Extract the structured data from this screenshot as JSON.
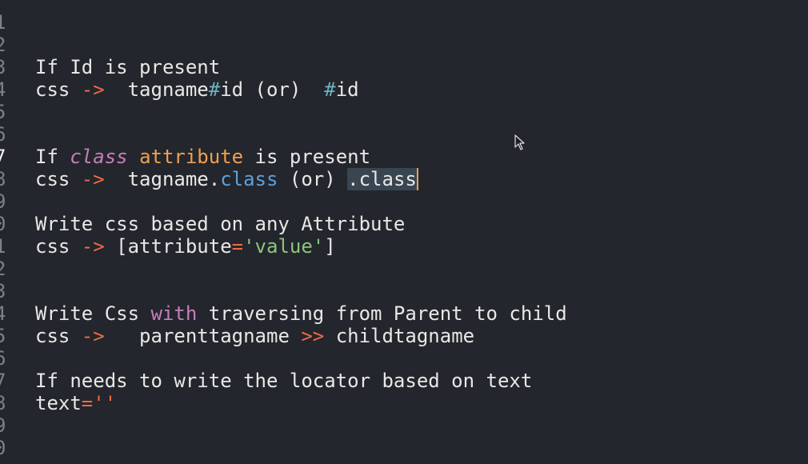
{
  "editor": {
    "line_numbers": [
      "1",
      "2",
      "3",
      "4",
      "5",
      "6",
      "7",
      "8",
      "9",
      "0",
      "1",
      "2",
      "3",
      "4",
      "5",
      "6",
      "7",
      "8",
      "9",
      "0"
    ],
    "active_line_number": "7",
    "lines": {
      "l2": {
        "text": "If Id is present"
      },
      "l3": {
        "a": "css ",
        "arrow": "->",
        "b": "  tagname",
        "hash": "#",
        "c": "id (or)  ",
        "hash2": "#",
        "d": "id"
      },
      "l6": {
        "a": "If ",
        "kw": "class",
        "sp": " ",
        "attr": "attribute",
        "b": " is present"
      },
      "l7": {
        "a": "css ",
        "arrow": "->",
        "b": "  tagname",
        "dot": ".",
        "prop": "class",
        "c": " (or) ",
        "sel": ".class"
      },
      "l9": {
        "text": "Write css based on any Attribute"
      },
      "l10": {
        "a": "css ",
        "arrow": "->",
        "b": " [attribute",
        "eq": "=",
        "str": "'value'",
        "c": "]"
      },
      "l13": {
        "a": "Write Css ",
        "with": "with",
        "b": " traversing from Parent to child"
      },
      "l14": {
        "a": "css ",
        "arrow": "->",
        "b": "   parenttagname ",
        "gg": ">>",
        "c": " childtagname"
      },
      "l16": {
        "text": "If needs to write the locator based on text"
      },
      "l17": {
        "a": "text",
        "eq": "=",
        "str": "''"
      }
    }
  }
}
